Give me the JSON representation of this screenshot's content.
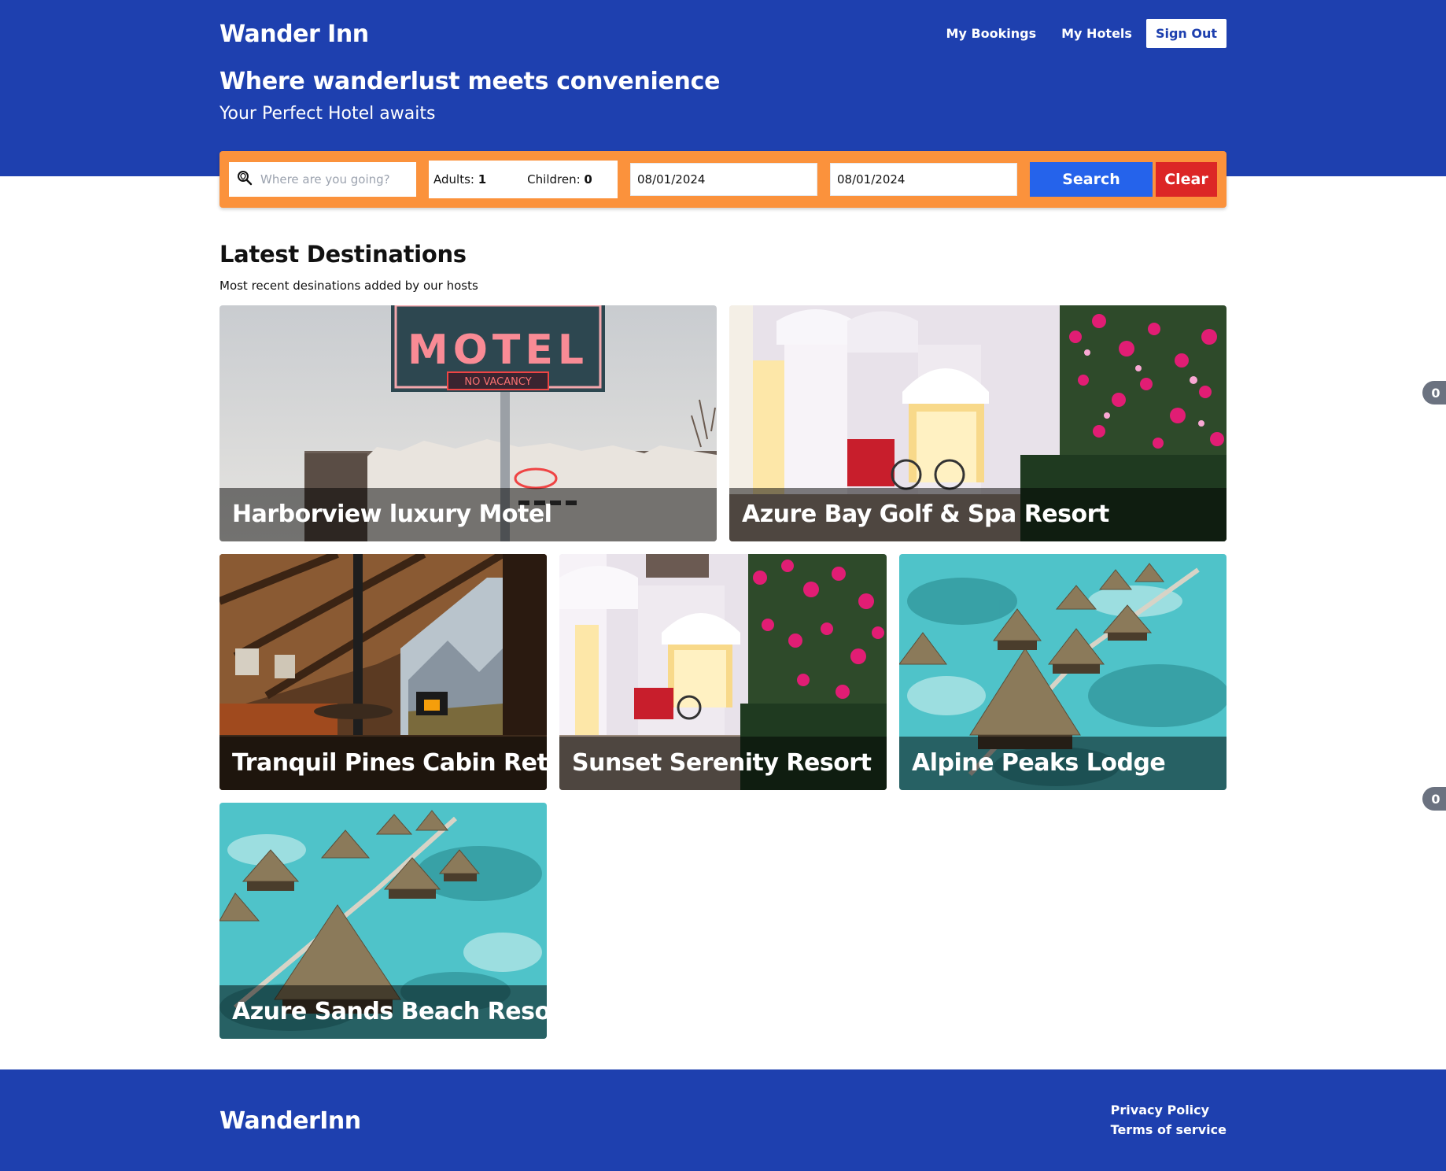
{
  "header": {
    "brand": "Wander Inn",
    "nav": {
      "my_bookings": "My Bookings",
      "my_hotels": "My Hotels",
      "sign_out": "Sign Out"
    },
    "tagline": "Where wanderlust meets convenience",
    "subline": "Your Perfect Hotel awaits"
  },
  "search": {
    "destination_placeholder": "Where are you going?",
    "destination_value": "",
    "adults_label": "Adults:",
    "adults_value": "1",
    "children_label": "Children:",
    "children_value": "0",
    "check_in": "08/01/2024",
    "check_out": "08/01/2024",
    "search_label": "Search",
    "clear_label": "Clear"
  },
  "section": {
    "title": "Latest Destinations",
    "subtitle": "Most recent desinations added by our hosts"
  },
  "destinations": [
    {
      "name": "Harborview luxury Motel",
      "image": "motel-neon-sign"
    },
    {
      "name": "Azure Bay Golf & Spa Resort",
      "image": "white-resort-flowers"
    },
    {
      "name": "Tranquil Pines Cabin Retreat",
      "image": "cabin-interior"
    },
    {
      "name": "Sunset Serenity Resort",
      "image": "white-resort-flowers"
    },
    {
      "name": "Alpine Peaks Lodge",
      "image": "overwater-bungalows"
    },
    {
      "name": "Azure Sands Beach Resort",
      "image": "overwater-bungalows"
    }
  ],
  "footer": {
    "brand": "WanderInn",
    "privacy": "Privacy Policy",
    "terms": "Terms of service"
  },
  "side_badges": [
    "0",
    "0"
  ],
  "colors": {
    "primary": "#1e40af",
    "search_bar": "#fb923c",
    "search_button": "#2563eb",
    "clear_button": "#dc2626"
  }
}
